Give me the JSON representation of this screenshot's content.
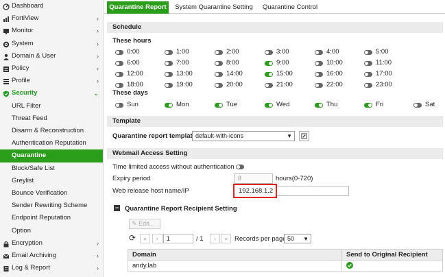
{
  "sidebar": {
    "items": [
      {
        "label": "Dashboard",
        "icon": "dashboard-icon",
        "arrow": ""
      },
      {
        "label": "FortiView",
        "icon": "chart-icon",
        "arrow": "›"
      },
      {
        "label": "Monitor",
        "icon": "monitor-icon",
        "arrow": "›"
      },
      {
        "label": "System",
        "icon": "gear-icon",
        "arrow": "›"
      },
      {
        "label": "Domain & User",
        "icon": "user-icon",
        "arrow": "›"
      },
      {
        "label": "Policy",
        "icon": "policy-icon",
        "arrow": "›"
      },
      {
        "label": "Profile",
        "icon": "profile-icon",
        "arrow": "›"
      },
      {
        "label": "Security",
        "icon": "shield-icon",
        "arrow": "⌄"
      }
    ],
    "security_subitems": [
      "URL Filter",
      "Threat Feed",
      "Disarm & Reconstruction",
      "Authentication Reputation",
      "Quarantine",
      "Block/Safe List",
      "Greylist",
      "Bounce Verification",
      "Sender Rewriting Scheme",
      "Endpoint Reputation",
      "Option"
    ],
    "bottom_items": [
      {
        "label": "Encryption",
        "icon": "lock-icon",
        "arrow": "›"
      },
      {
        "label": "Email Archiving",
        "icon": "mail-icon",
        "arrow": "›"
      },
      {
        "label": "Log & Report",
        "icon": "report-icon",
        "arrow": "›"
      }
    ],
    "selected": "Quarantine"
  },
  "tabs": [
    "Quarantine Report",
    "System Quarantine Setting",
    "Quarantine Control"
  ],
  "schedule": {
    "header": "Schedule",
    "hours_label": "These hours",
    "hours": [
      {
        "t": "0:00",
        "on": false
      },
      {
        "t": "1:00",
        "on": false
      },
      {
        "t": "2:00",
        "on": false
      },
      {
        "t": "3:00",
        "on": false
      },
      {
        "t": "4:00",
        "on": false
      },
      {
        "t": "5:00",
        "on": false
      },
      {
        "t": "6:00",
        "on": false
      },
      {
        "t": "7:00",
        "on": false
      },
      {
        "t": "8:00",
        "on": false
      },
      {
        "t": "9:00",
        "on": true
      },
      {
        "t": "10:00",
        "on": false
      },
      {
        "t": "11:00",
        "on": false
      },
      {
        "t": "12:00",
        "on": false
      },
      {
        "t": "13:00",
        "on": false
      },
      {
        "t": "14:00",
        "on": false
      },
      {
        "t": "15:00",
        "on": true
      },
      {
        "t": "16:00",
        "on": false
      },
      {
        "t": "17:00",
        "on": false
      },
      {
        "t": "18:00",
        "on": false
      },
      {
        "t": "19:00",
        "on": false
      },
      {
        "t": "20:00",
        "on": false
      },
      {
        "t": "21:00",
        "on": false
      },
      {
        "t": "22:00",
        "on": false
      },
      {
        "t": "23:00",
        "on": false
      }
    ],
    "days_label": "These days",
    "days": [
      {
        "d": "Sun",
        "on": false
      },
      {
        "d": "Mon",
        "on": true
      },
      {
        "d": "Tue",
        "on": true
      },
      {
        "d": "Wed",
        "on": true
      },
      {
        "d": "Thu",
        "on": true
      },
      {
        "d": "Fri",
        "on": true
      },
      {
        "d": "Sat",
        "on": false
      }
    ]
  },
  "template": {
    "header": "Template",
    "label": "Quarantine report template",
    "value": "default-with-icons"
  },
  "webmail": {
    "header": "Webmail Access Setting",
    "time_limited_label": "Time limited access without authentication",
    "time_limited_on": false,
    "expiry_label": "Expiry period",
    "expiry_value": "8",
    "expiry_unit": "hours(0-720)",
    "host_label": "Web release host name/IP",
    "host_value": "192.168.1.2"
  },
  "recipient": {
    "header": "Quarantine Report Recipient Setting",
    "collapse_glyph": "−",
    "edit_label": "Edit...",
    "page_current": "1",
    "page_total": "/ 1",
    "records_label": "Records per page",
    "records_value": "50",
    "columns": [
      "Domain",
      "Send to Original Recipient"
    ],
    "rows": [
      {
        "domain": "andy.lab",
        "send": true
      }
    ]
  },
  "colors": {
    "accent": "#2a9d1b",
    "highlight": "#e0241b"
  }
}
